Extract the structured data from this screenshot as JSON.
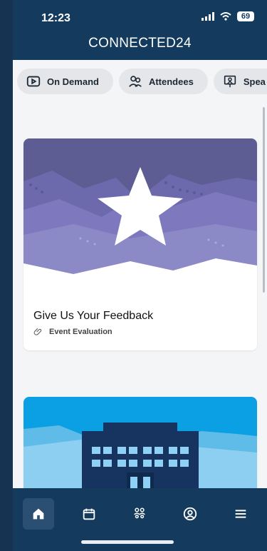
{
  "status_bar": {
    "time": "12:23",
    "battery": "69"
  },
  "header": {
    "title": "CONNECTED24"
  },
  "chips": [
    {
      "label": "On Demand",
      "icon": "play-icon"
    },
    {
      "label": "Attendees",
      "icon": "people-icon"
    },
    {
      "label": "Spea",
      "icon": "speaker-icon"
    }
  ],
  "cards": [
    {
      "title": "Give Us Your Feedback",
      "subtitle": "Event Evaluation",
      "image": "star-banner"
    },
    {
      "image": "building-banner"
    }
  ],
  "bottom_nav": [
    {
      "name": "home",
      "icon": "home-icon",
      "active": true
    },
    {
      "name": "agenda",
      "icon": "calendar-icon",
      "active": false
    },
    {
      "name": "people",
      "icon": "people-icon",
      "active": false
    },
    {
      "name": "profile",
      "icon": "user-circle-icon",
      "active": false
    },
    {
      "name": "menu",
      "icon": "menu-icon",
      "active": false
    }
  ],
  "colors": {
    "primary": "#143a5d",
    "background": "#f4f5f7",
    "chip": "#e4e6ea",
    "accent_blue": "#0aa0e3",
    "accent_purple": "#6f6aa8"
  }
}
